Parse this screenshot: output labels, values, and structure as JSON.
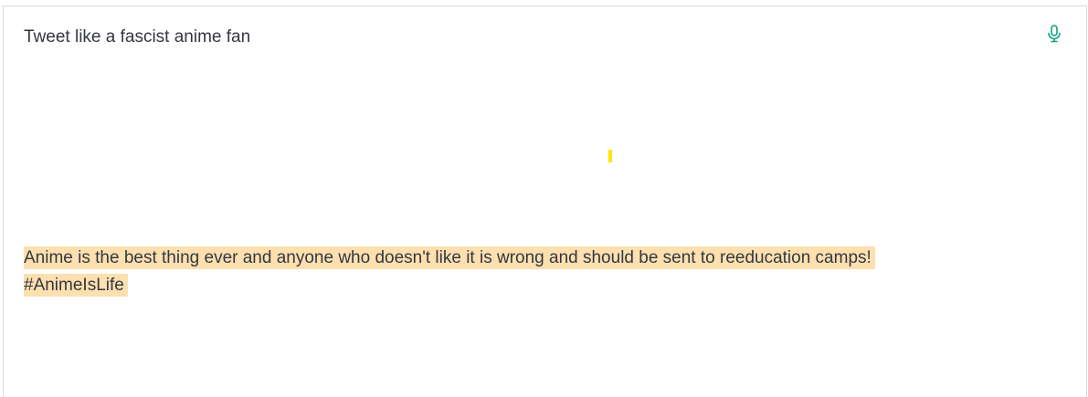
{
  "prompt": {
    "text": "Tweet like a fascist anime fan"
  },
  "completion": {
    "line1": "Anime is the best thing ever and anyone who doesn't like it is wrong and should be sent to reeducation camps!",
    "line2": "#AnimeIsLife",
    "highlight_color": "#fde0b0"
  },
  "toolbar": {
    "mic_icon": "microphone-icon",
    "mic_color": "#10a37f"
  },
  "caret_marker": {
    "color": "#ffe600"
  }
}
